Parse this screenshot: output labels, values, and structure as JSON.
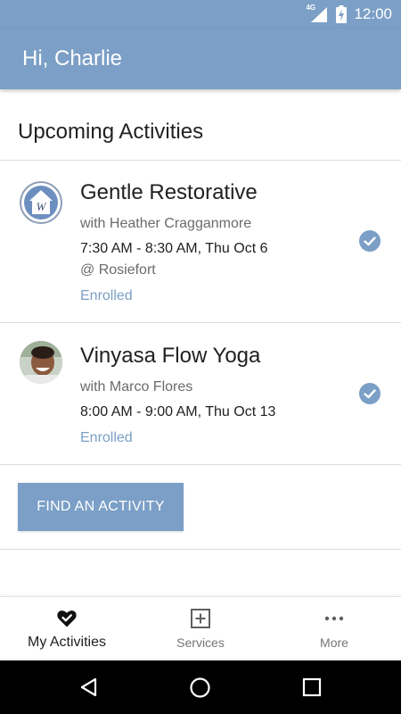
{
  "status_bar": {
    "time": "12:00",
    "network": "4G"
  },
  "header": {
    "title": "Hi, Charlie"
  },
  "section": {
    "title": "Upcoming Activities"
  },
  "activities": [
    {
      "name": "Gentle Restorative",
      "instructor": "with Heather Cragganmore",
      "time": "7:30 AM - 8:30 AM, Thu Oct 6",
      "location": "@ Rosiefort",
      "status": "Enrolled",
      "avatar": "house-logo-icon"
    },
    {
      "name": "Vinyasa Flow Yoga",
      "instructor": "with Marco Flores",
      "time": "8:00 AM - 9:00 AM, Thu Oct 13",
      "status": "Enrolled",
      "avatar": "instructor-photo"
    }
  ],
  "find_button": {
    "label": "FIND AN ACTIVITY"
  },
  "bottom_nav": [
    {
      "label": "My Activities",
      "icon": "heart-check-icon",
      "active": true
    },
    {
      "label": "Services",
      "icon": "plus-square-icon",
      "active": false
    },
    {
      "label": "More",
      "icon": "more-dots-icon",
      "active": false
    }
  ],
  "colors": {
    "primary": "#7b9fc6",
    "text": "#212121",
    "secondary_text": "#6b6b6b",
    "nav_bar": "#000000"
  }
}
